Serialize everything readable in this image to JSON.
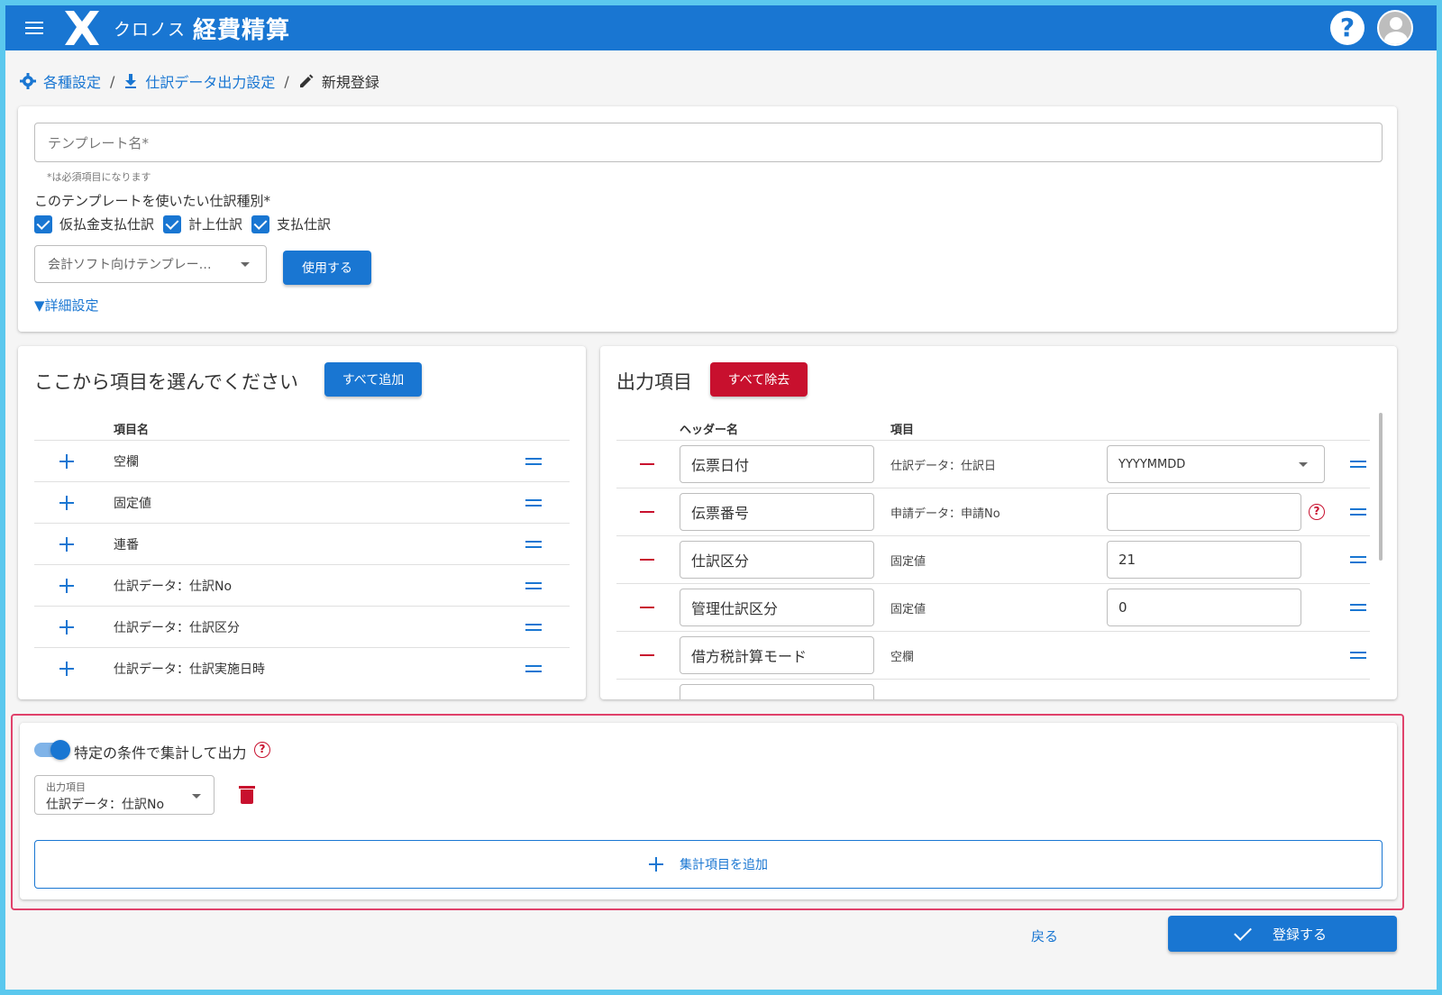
{
  "app": {
    "brand_small": "クロノス",
    "brand_big": "経費精算"
  },
  "breadcrumb": [
    "各種設定",
    "仕訳データ出力設定",
    "新規登録"
  ],
  "form": {
    "template_placeholder": "テンプレート名*",
    "required_note": "*は必須項目になります",
    "type_label": "このテンプレートを使いたい仕訳種別*",
    "checkboxes": [
      "仮払金支払仕訳",
      "計上仕訳",
      "支払仕訳"
    ],
    "template_select": "会計ソフト向けテンプレー…",
    "use_button": "使用する",
    "detail_link": "▼詳細設定"
  },
  "available": {
    "title": "ここから項目を選んでください",
    "add_all": "すべて追加",
    "column": "項目名",
    "items": [
      "空欄",
      "固定値",
      "連番",
      "仕訳データ：仕訳No",
      "仕訳データ：仕訳区分",
      "仕訳データ：仕訳実施日時"
    ]
  },
  "output": {
    "title": "出力項目",
    "remove_all": "すべて除去",
    "columns": {
      "header": "ヘッダー名",
      "item": "項目"
    },
    "rows": [
      {
        "header": "伝票日付",
        "item": "仕訳データ：仕訳日",
        "value": "YYYYMMDD"
      },
      {
        "header": "伝票番号",
        "item": "申請データ：申請No",
        "value": ""
      },
      {
        "header": "仕訳区分",
        "item": "固定値",
        "value": "21"
      },
      {
        "header": "管理仕訳区分",
        "item": "固定値",
        "value": "0"
      },
      {
        "header": "借方税計算モード",
        "item": "空欄",
        "value": ""
      }
    ]
  },
  "aggregate": {
    "toggle_label": "特定の条件で集計して出力",
    "select_label": "出力項目",
    "select_value": "仕訳データ：仕訳No",
    "add_button": "集計項目を追加"
  },
  "footer": {
    "back": "戻る",
    "register": "登録する"
  },
  "colors": {
    "primary": "#1976d2",
    "danger": "#c8102e",
    "highlight": "#e0426b"
  }
}
